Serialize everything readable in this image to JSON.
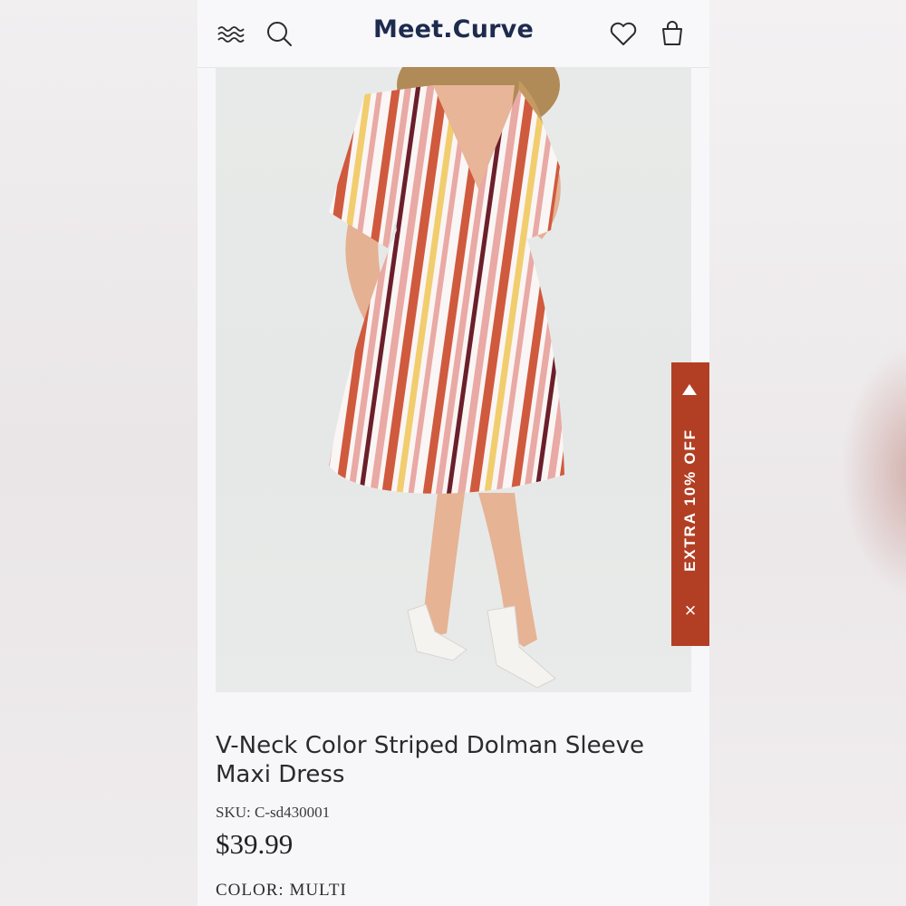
{
  "header": {
    "brand": "Meet.Curve",
    "icons": [
      "menu-icon",
      "search-icon",
      "wishlist-heart-icon",
      "shopping-bag-icon"
    ]
  },
  "product": {
    "title": "V-Neck Color Striped Dolman Sleeve Maxi Dress",
    "sku_label": "SKU:",
    "sku": "C-sd430001",
    "price": "$39.99",
    "color_label": "COLOR:",
    "color_value": "MULTI"
  },
  "promo": {
    "text": "EXTRA 10% OFF",
    "color": "#b23f24"
  },
  "colors": {
    "brand": "#1e2b4e",
    "stripe_rust": "#d05a3e",
    "stripe_pink": "#e9a9a4",
    "stripe_yellow": "#f1cd6e",
    "stripe_maroon": "#6b1f2a"
  }
}
